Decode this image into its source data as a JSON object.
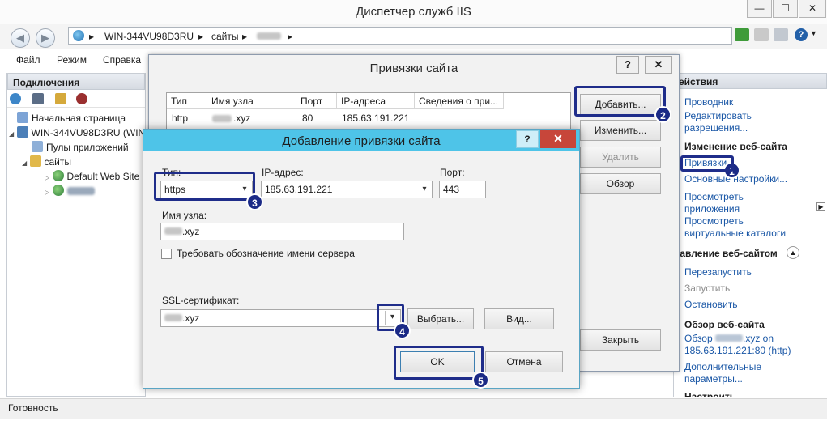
{
  "app": {
    "title": "Диспетчер служб IIS",
    "window_controls": [
      "—",
      "☐",
      "✕"
    ]
  },
  "address": {
    "crumbs": [
      "WIN-344VU98D3RU",
      "сайты"
    ],
    "separator": "▸"
  },
  "menu": {
    "items": [
      "Файл",
      "Режим",
      "Справка"
    ]
  },
  "connections": {
    "header": "Подключения",
    "tree": {
      "start_page": "Начальная страница",
      "server": "WIN-344VU98D3RU (WIN",
      "app_pools": "Пулы приложений",
      "sites": "сайты",
      "default_site": "Default Web Site"
    }
  },
  "actions": {
    "header": "ействия",
    "explorer": "Проводник",
    "edit_permissions": "Редактировать разрешения...",
    "edit_site_header": "Изменение веб-сайта",
    "bindings": "Привязки...",
    "basic_settings": "Основные настройки...",
    "view_apps_1": "Просмотреть",
    "view_apps_2": "приложения",
    "view_vdirs_1": "Просмотреть",
    "view_vdirs_2": "виртуальные каталоги",
    "manage_header": "равление веб-сайтом",
    "restart": "Перезапустить",
    "start": "Запустить",
    "stop": "Остановить",
    "browse_header": "Обзор веб-сайта",
    "browse_prefix": "Обзор",
    "browse_suffix": ".xyz on",
    "browse_address": "185.63.191.221:80 (http)",
    "advanced_1": "Дополнительные",
    "advanced_2": "параметры...",
    "cut_header": "Настроить"
  },
  "status": {
    "text": "Готовность"
  },
  "bindings_dialog": {
    "title": "Привязки сайта",
    "help": "?",
    "close": "✕",
    "columns": [
      "Тип",
      "Имя узла",
      "Порт",
      "IP-адреса",
      "Сведения о при..."
    ],
    "rows": [
      {
        "type": "http",
        "host_suffix": ".xyz",
        "port": "80",
        "ip": "185.63.191.221",
        "info": ""
      }
    ],
    "buttons": {
      "add": "Добавить...",
      "edit": "Изменить...",
      "remove": "Удалить",
      "browse": "Обзор",
      "close": "Закрыть"
    }
  },
  "add_dialog": {
    "title": "Добавление привязки сайта",
    "help": "?",
    "close": "✕",
    "type_label": "Тип:",
    "type_value": "https",
    "ip_label": "IP-адрес:",
    "ip_value": "185.63.191.221",
    "port_label": "Порт:",
    "port_value": "443",
    "host_label": "Имя узла:",
    "host_suffix": ".xyz",
    "sni_label": "Требовать обозначение имени сервера",
    "sni_checked": false,
    "ssl_label": "SSL-сертификат:",
    "ssl_suffix": ".xyz",
    "select_button": "Выбрать...",
    "view_button": "Вид...",
    "ok": "OK",
    "cancel": "Отмена"
  },
  "annotations": [
    "1",
    "2",
    "3",
    "4",
    "5"
  ],
  "colors": {
    "annotation": "#1b2a86",
    "link": "#1a57a6",
    "add_dialog_titlebar": "#4ec4e8",
    "close_red": "#c7463a"
  }
}
